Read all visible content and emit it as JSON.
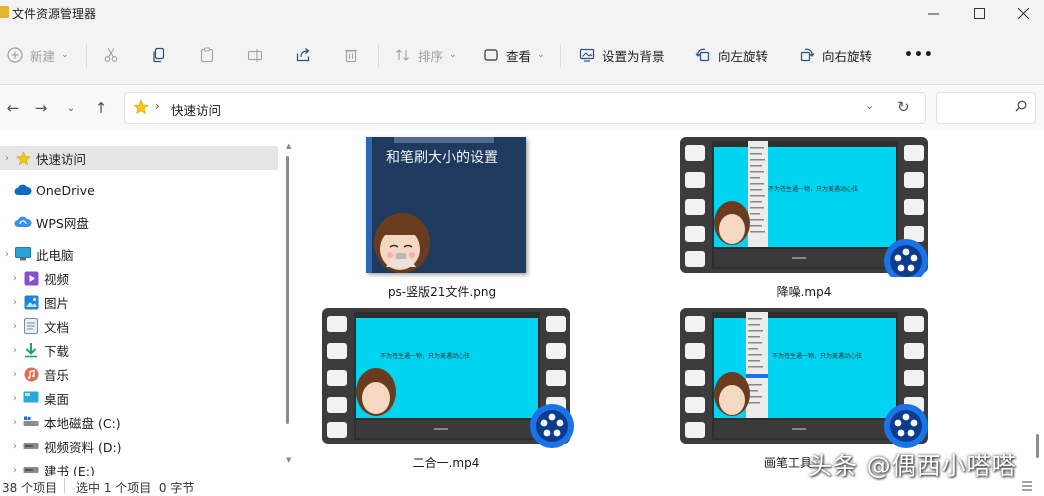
{
  "window": {
    "title": "文件资源管理器",
    "controls": [
      "—",
      "☐",
      "✕"
    ]
  },
  "toolbar": {
    "new_label": "新建",
    "sort_label": "排序",
    "view_label": "查看",
    "set_bg_label": "设置为背景",
    "rotate_left_label": "向左旋转",
    "rotate_right_label": "向右旋转",
    "more_label": "•••"
  },
  "address": {
    "path_label": "快速访问",
    "search_placeholder": ""
  },
  "sidebar": {
    "items": [
      {
        "label": "快速访问",
        "icon": "star-icon",
        "selected": true
      },
      {
        "label": "OneDrive",
        "icon": "cloud-icon"
      },
      {
        "label": "WPS网盘",
        "icon": "wps-cloud-icon"
      },
      {
        "label": "此电脑",
        "icon": "computer-icon"
      },
      {
        "label": "视频",
        "icon": "video-folder-icon"
      },
      {
        "label": "图片",
        "icon": "picture-folder-icon"
      },
      {
        "label": "文档",
        "icon": "document-folder-icon"
      },
      {
        "label": "下载",
        "icon": "download-icon"
      },
      {
        "label": "音乐",
        "icon": "music-icon"
      },
      {
        "label": "桌面",
        "icon": "desktop-icon"
      },
      {
        "label": "本地磁盘 (C:)",
        "icon": "drive-icon"
      },
      {
        "label": "视频资料 (D:)",
        "icon": "drive-icon"
      },
      {
        "label": "建书 (E:)",
        "icon": "drive-icon"
      }
    ]
  },
  "files": [
    {
      "name": "ps-竖版21文件.png",
      "type": "image",
      "caption": "和笔刷大小的设置"
    },
    {
      "name": "降噪.mp4",
      "type": "video",
      "overlay_text": "不为苍生通一物，只为美遇动心弦"
    },
    {
      "name": "二合一.mp4",
      "type": "video",
      "overlay_text": "不为苍生通一物，只为美遇动心弦"
    },
    {
      "name": "画笔工具",
      "type": "video",
      "overlay_text": "不为苍生通一物，只为美遇动心弦"
    }
  ],
  "status": {
    "item_count": "38 个项目",
    "selection": "选中 1 个项目  0 字节"
  },
  "watermark": "头条 @偶西小嗒嗒",
  "colors": {
    "accent": "#0067c0",
    "video_screen": "#00d4f0",
    "play_badge": "#1a73e8",
    "ps_bg": "#1e3a5f"
  }
}
